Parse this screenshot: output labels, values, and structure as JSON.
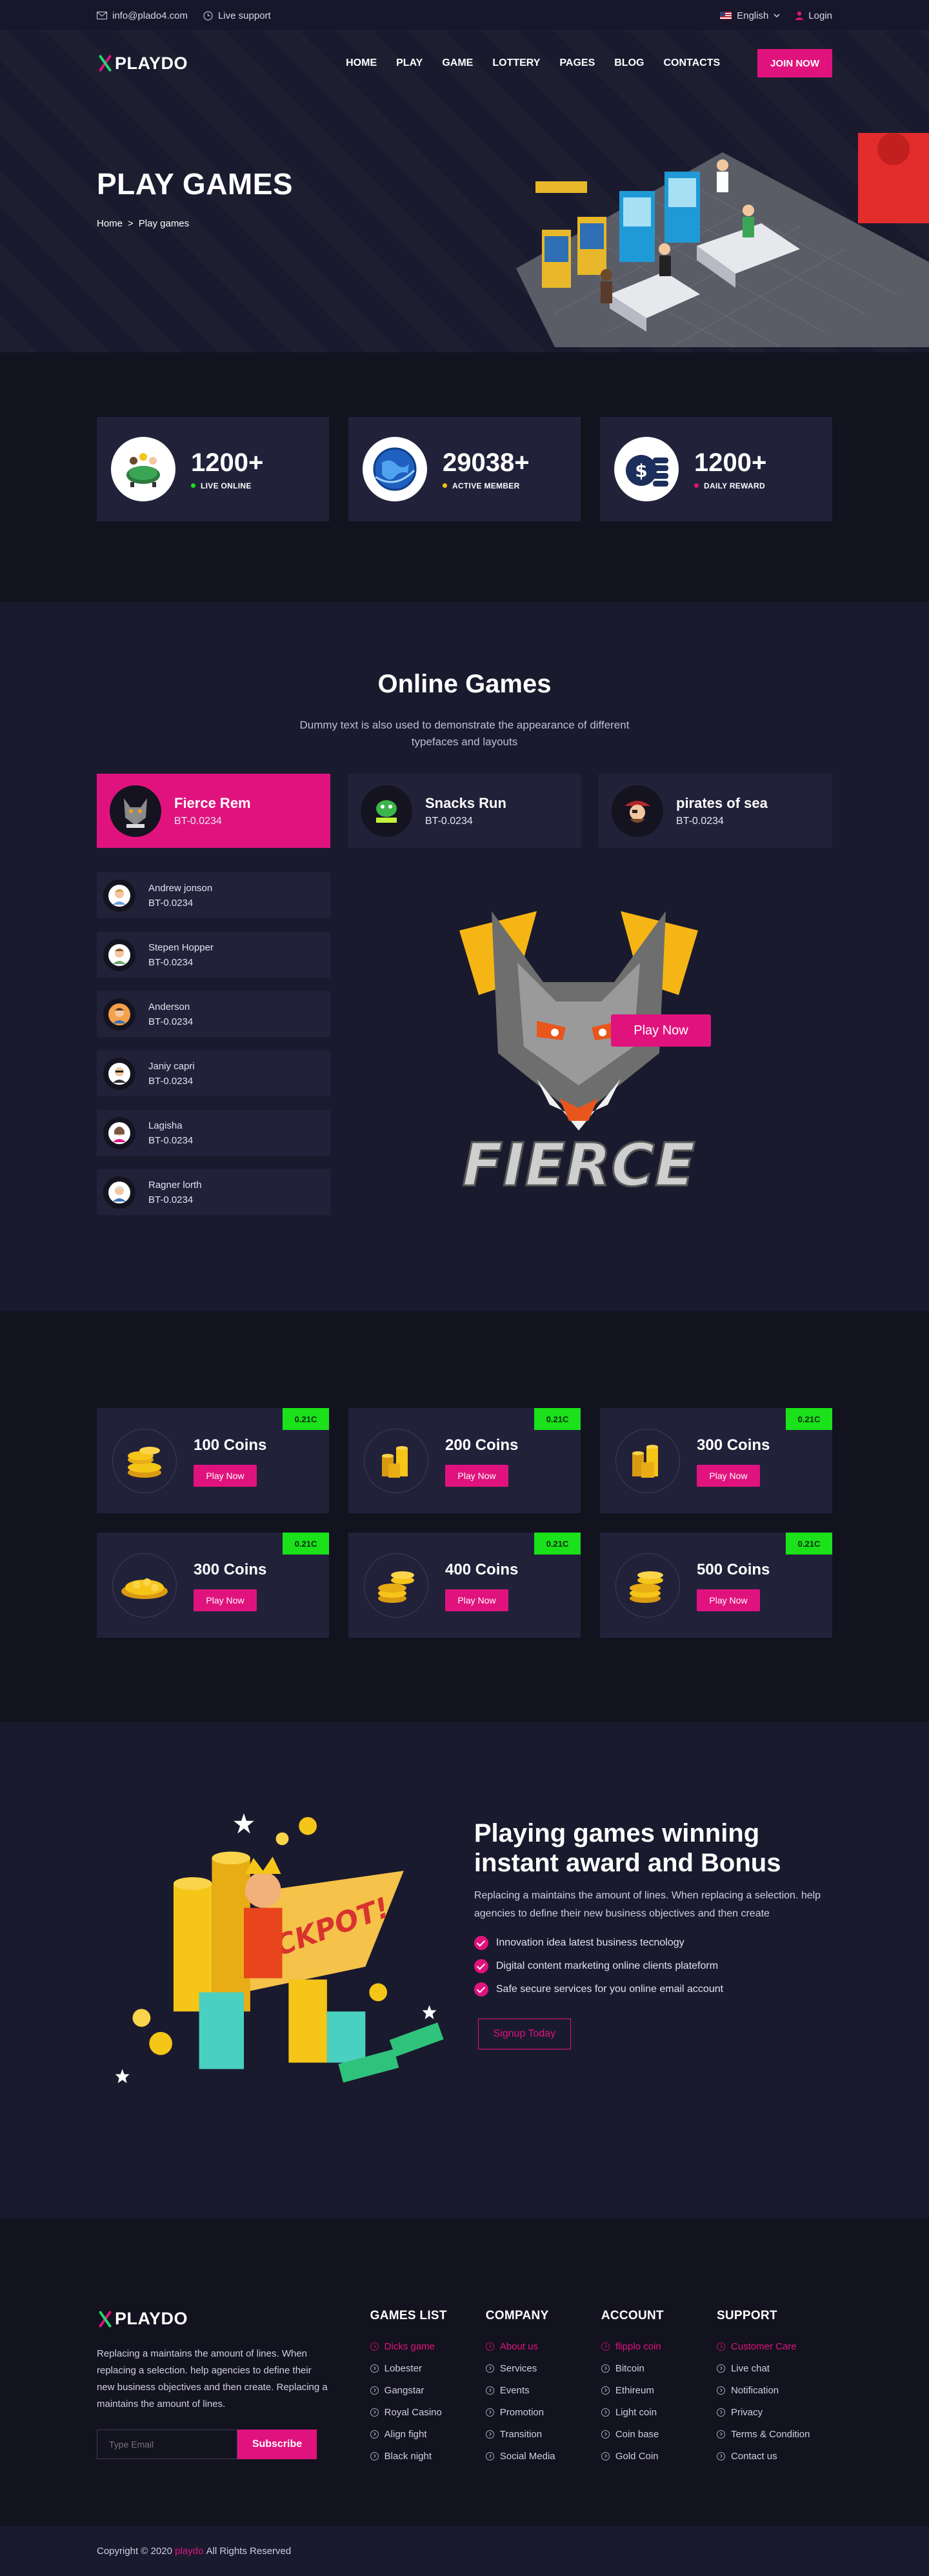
{
  "topbar": {
    "email": "info@plado4.com",
    "support": "Live support",
    "language": "English",
    "login": "Login"
  },
  "header": {
    "logo": "PLAYDO",
    "nav": [
      "HOME",
      "PLAY",
      "GAME",
      "LOTTERY",
      "PAGES",
      "BLOG",
      "CONTACTS"
    ],
    "join_label": "JOIN NOW"
  },
  "hero": {
    "title": "PLAY GAMES",
    "breadcrumb_home": "Home",
    "breadcrumb_sep": ">",
    "breadcrumb_current": "Play games"
  },
  "stats": [
    {
      "value": "1200+",
      "label": "LIVE ONLINE",
      "dot_color": "#1ae11a",
      "icon": "casino-table-icon"
    },
    {
      "value": "29038+",
      "label": "ACTIVE MEMBER",
      "dot_color": "#f5c518",
      "icon": "globe-icon"
    },
    {
      "value": "1200+",
      "label": "DAILY REWARD",
      "dot_color": "#e0137e",
      "icon": "dollar-coins-icon"
    }
  ],
  "online_games": {
    "title": "Online Games",
    "subtitle": "Dummy text is also used to demonstrate the appearance of different typefaces and layouts",
    "tabs": [
      {
        "name": "Fierce Rem",
        "value": "BT-0.0234"
      },
      {
        "name": "Snacks Run",
        "value": "BT-0.0234"
      },
      {
        "name": "pirates of sea",
        "value": "BT-0.0234"
      }
    ],
    "players": [
      {
        "name": "Andrew jonson",
        "value": "BT-0.0234"
      },
      {
        "name": "Stepen Hopper",
        "value": "BT-0.0234"
      },
      {
        "name": "Anderson",
        "value": "BT-0.0234"
      },
      {
        "name": "Janiy capri",
        "value": "BT-0.0234"
      },
      {
        "name": "Lagisha",
        "value": "BT-0.0234"
      },
      {
        "name": "Ragner lorth",
        "value": "BT-0.0234"
      }
    ],
    "featured_logo_text": "FIERCE",
    "play_now": "Play Now"
  },
  "coins": [
    {
      "title": "100 Coins",
      "badge": "0.21C",
      "button": "Play Now"
    },
    {
      "title": "200 Coins",
      "badge": "0.21C",
      "button": "Play Now"
    },
    {
      "title": "300 Coins",
      "badge": "0.21C",
      "button": "Play Now"
    },
    {
      "title": "300 Coins",
      "badge": "0.21C",
      "button": "Play Now"
    },
    {
      "title": "400 Coins",
      "badge": "0.21C",
      "button": "Play Now"
    },
    {
      "title": "500 Coins",
      "badge": "0.21C",
      "button": "Play Now"
    }
  ],
  "jackpot": {
    "title": "Playing games winning instant award and Bonus",
    "description": "Replacing a maintains the amount of lines. When replacing a selection. help agencies to define their new business objectives and then create",
    "features": [
      "Innovation idea latest business tecnology",
      "Digital content marketing online clients plateform",
      "Safe secure services for you online email account"
    ],
    "signup": "Signup Today",
    "art_text": "JACKPOT!"
  },
  "footer": {
    "logo": "PLAYDO",
    "about": "Replacing a maintains the amount of lines. When replacing a selection. help agencies to define their new business objectives and then create. Replacing a maintains the amount of lines.",
    "email_placeholder": "Type Email",
    "subscribe": "Subscribe",
    "columns": [
      {
        "title": "GAMES LIST",
        "items": [
          "Dicks game",
          "Lobester",
          "Gangstar",
          "Royal Casino",
          "Align fight",
          "Black night"
        ]
      },
      {
        "title": "COMPANY",
        "items": [
          "About us",
          "Services",
          "Events",
          "Promotion",
          "Transition",
          "Social Media"
        ]
      },
      {
        "title": "ACCOUNT",
        "items": [
          "flipplo coin",
          "Bitcoin",
          "Ethireum",
          "Light coin",
          "Coin base",
          "Gold Coin"
        ]
      },
      {
        "title": "SUPPORT",
        "items": [
          "Customer Care",
          "Live chat",
          "Notification",
          "Privacy",
          "Terms & Condition",
          "Contact us"
        ]
      }
    ]
  },
  "copyright": {
    "prefix": "Copyright © 2020",
    "brand": "playdo",
    "suffix": "All Rights Reserved"
  },
  "colors": {
    "accent": "#e0137e",
    "badge": "#1ae11a",
    "background": "#13121f",
    "card": "#22213a"
  }
}
